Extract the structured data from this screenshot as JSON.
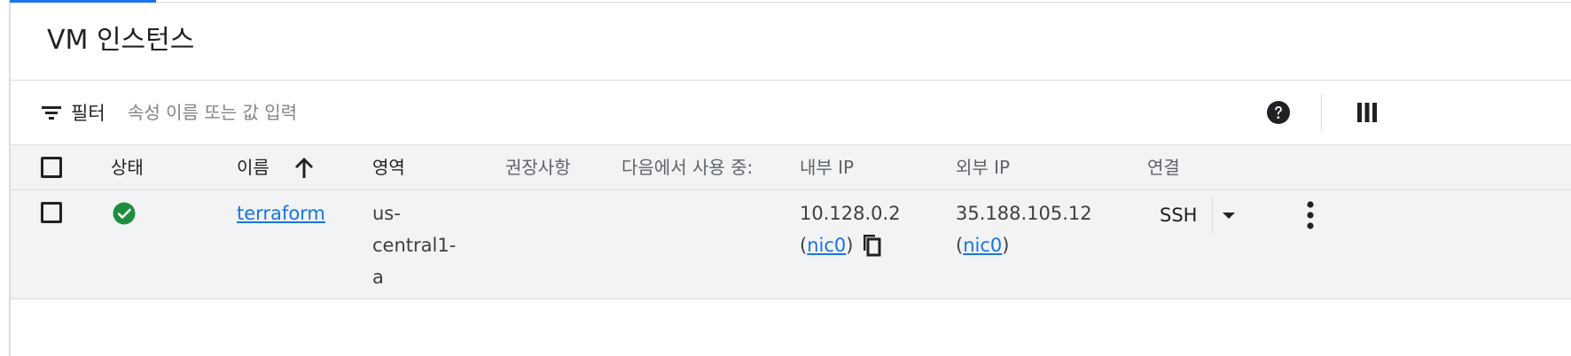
{
  "page": {
    "title": "VM 인스턴스"
  },
  "filter": {
    "label": "필터",
    "placeholder": "속성 이름 또는 값 입력"
  },
  "table": {
    "columns": {
      "status": "상태",
      "name": "이름",
      "zone": "영역",
      "recommendation": "권장사항",
      "in_use_by": "다음에서 사용 중:",
      "internal_ip": "내부 IP",
      "external_ip": "외부 IP",
      "connect": "연결"
    },
    "sort": {
      "column": "name",
      "direction": "ascending",
      "icon": "arrow-up-icon"
    },
    "rows": [
      {
        "status": "running",
        "status_icon": "check-circle-icon",
        "name": "terraform",
        "zone_lines": [
          "us-",
          "central1-",
          "a"
        ],
        "recommendation": "",
        "in_use_by": "",
        "internal_ip": "10.128.0.2",
        "internal_nic": "nic0",
        "external_ip": "35.188.105.12",
        "external_nic": "nic0",
        "connect_label": "SSH",
        "paren_open": "(",
        "paren_close": ")"
      }
    ]
  },
  "colors": {
    "accent": "#1a73e8",
    "status_ok": "#1e8e3e",
    "row_bg": "#f1f3f4"
  },
  "icons": [
    "filter-icon",
    "help-icon",
    "columns-icon",
    "arrow-up-icon",
    "check-circle-icon",
    "copy-icon",
    "dropdown-arrow-icon",
    "more-vert-icon"
  ]
}
